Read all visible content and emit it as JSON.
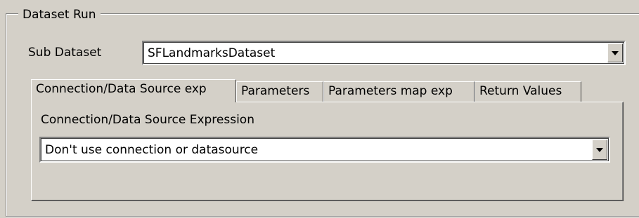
{
  "group": {
    "title": "Dataset Run"
  },
  "sub_dataset": {
    "label": "Sub Dataset",
    "value": "SFLandmarksDataset",
    "dropdown_icon": "chevron-down-icon"
  },
  "tabs": [
    {
      "label": "Connection/Data Source exp",
      "active": true
    },
    {
      "label": "Parameters",
      "active": false
    },
    {
      "label": "Parameters map exp",
      "active": false
    },
    {
      "label": "Return Values",
      "active": false
    }
  ],
  "connection": {
    "label": "Connection/Data Source Expression",
    "value": "Don't use connection or datasource",
    "dropdown_icon": "chevron-down-icon"
  }
}
